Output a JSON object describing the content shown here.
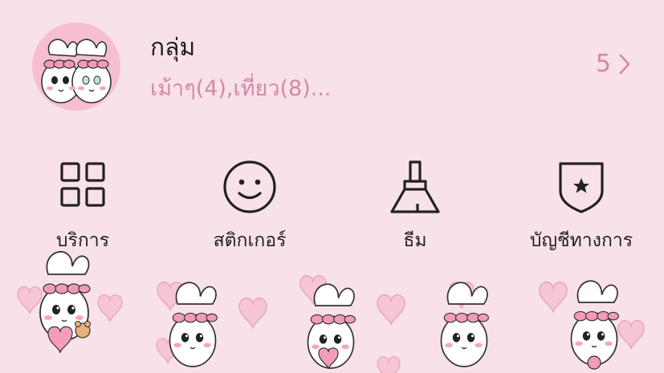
{
  "group": {
    "title": "กลุ่ม",
    "members": "เม้าๆ(4),เที่ยว(8)...",
    "count": "5"
  },
  "menu": [
    {
      "label": "บริการ",
      "icon": "grid-icon"
    },
    {
      "label": "สติกเกอร์",
      "icon": "smiley-icon"
    },
    {
      "label": "ธีม",
      "icon": "brush-icon"
    },
    {
      "label": "บัญชีทางการ",
      "icon": "official-shield-icon"
    }
  ],
  "colors": {
    "background": "#f9e1ea",
    "accent_pink": "#d28aa4",
    "avatar_bg": "#f6bfd1",
    "icon_stroke": "#222222"
  }
}
